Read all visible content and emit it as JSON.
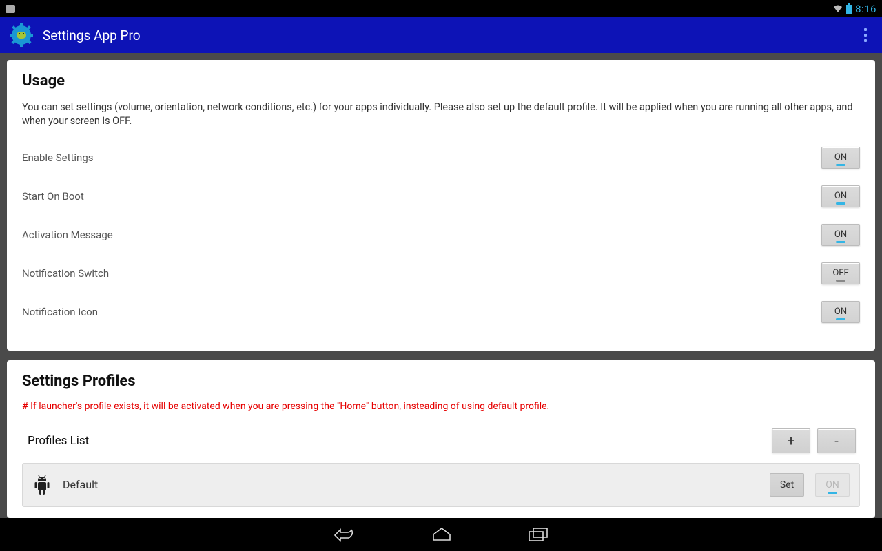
{
  "status": {
    "clock": "8:16"
  },
  "app": {
    "title": "Settings App Pro"
  },
  "usage": {
    "heading": "Usage",
    "description": "You can set settings (volume, orientation, network conditions, etc.) for your apps individually. Please also set up the default profile. It will be applied when you are running all other apps, and when your screen is OFF.",
    "toggles": [
      {
        "label": "Enable Settings",
        "state": "ON"
      },
      {
        "label": "Start On Boot",
        "state": "ON"
      },
      {
        "label": "Activation Message",
        "state": "ON"
      },
      {
        "label": "Notification Switch",
        "state": "OFF"
      },
      {
        "label": "Notification Icon",
        "state": "ON"
      }
    ]
  },
  "profiles": {
    "heading": "Settings Profiles",
    "note": "# If launcher's profile exists, it will be activated when you are pressing the \"Home\" button, insteading of using default profile.",
    "list_title": "Profiles List",
    "add_label": "+",
    "remove_label": "-",
    "items": [
      {
        "name": "Default",
        "set_label": "Set",
        "on_label": "ON"
      }
    ]
  }
}
